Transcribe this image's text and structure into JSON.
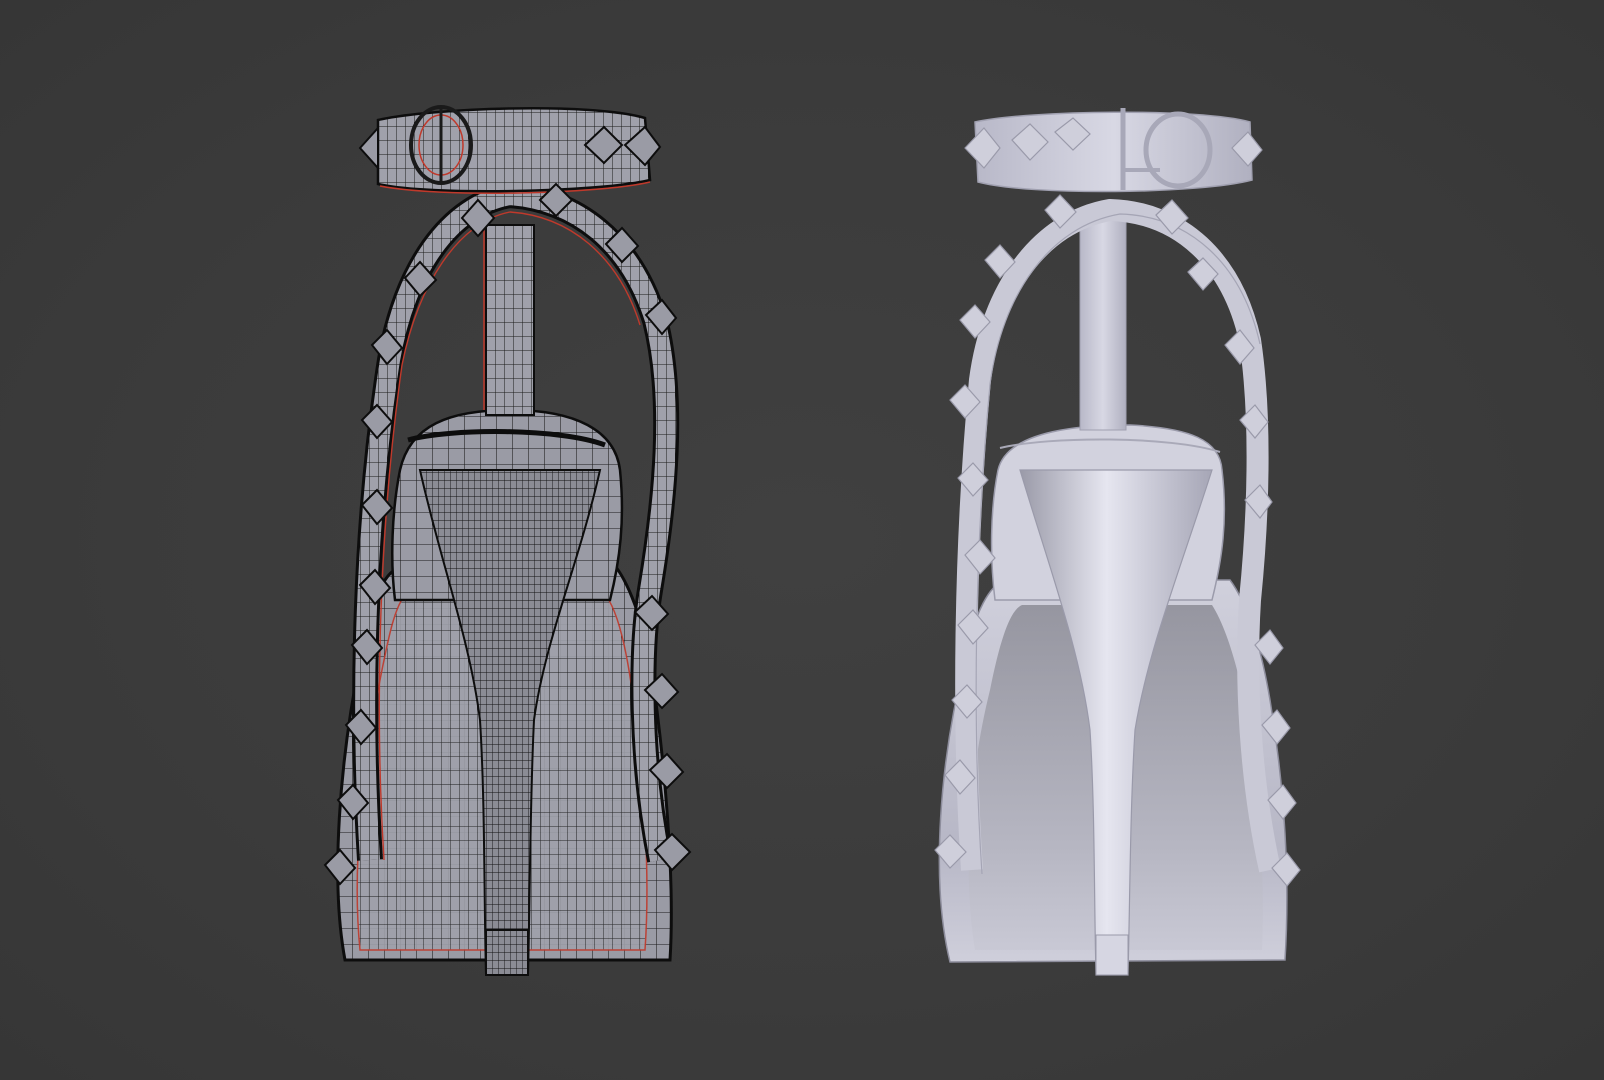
{
  "viewport": {
    "background": "#3c3c3c",
    "mode": "3d-viewport"
  },
  "objects": [
    {
      "name": "studded-heel-sandal",
      "display": "wireframe-edit",
      "mesh_color": "#8e8f98",
      "wire_color": "#111111",
      "seam_color": "#c0392b"
    },
    {
      "name": "studded-heel-sandal",
      "display": "solid",
      "mesh_color": "#c6c6d6"
    }
  ]
}
